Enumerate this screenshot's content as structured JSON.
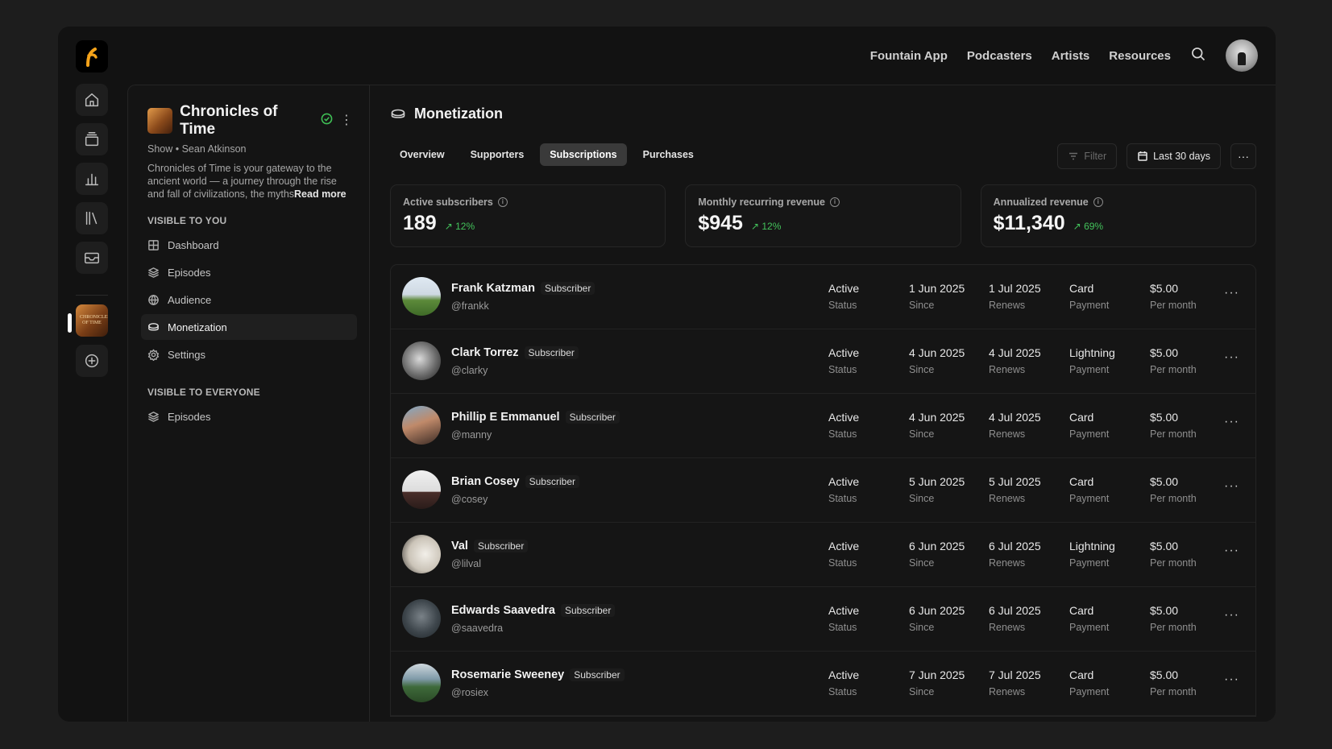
{
  "topnav": {
    "links": [
      "Fountain App",
      "Podcasters",
      "Artists",
      "Resources"
    ]
  },
  "rail": {
    "items": [
      "home-icon",
      "layers-icon",
      "analytics-icon",
      "library-icon",
      "inbox-icon"
    ],
    "cover_text": "CHRONICLES OF TIME"
  },
  "show": {
    "title": "Chronicles of Time",
    "meta": "Show • Sean Atkinson",
    "description": "Chronicles of Time is your gateway to the ancient world — a journey through the rise and fall of civilizations, the myths",
    "read_more": "Read more"
  },
  "sidebar": {
    "visible_to_you": "VISIBLE TO YOU",
    "items_you": [
      {
        "label": "Dashboard",
        "icon": "dashboard-icon"
      },
      {
        "label": "Episodes",
        "icon": "episodes-icon"
      },
      {
        "label": "Audience",
        "icon": "audience-icon"
      },
      {
        "label": "Monetization",
        "icon": "monetization-icon",
        "active": true
      },
      {
        "label": "Settings",
        "icon": "settings-icon"
      }
    ],
    "visible_to_everyone": "VISIBLE TO EVERYONE",
    "items_everyone": [
      {
        "label": "Episodes",
        "icon": "episodes-icon"
      }
    ]
  },
  "page": {
    "title": "Monetization",
    "tabs": [
      "Overview",
      "Supporters",
      "Subscriptions",
      "Purchases"
    ],
    "active_tab": "Subscriptions",
    "filter_label": "Filter",
    "date_label": "Last 30 days"
  },
  "stats": [
    {
      "label": "Active subscribers",
      "value": "189",
      "delta": "12%"
    },
    {
      "label": "Monthly recurring revenue",
      "value": "$945",
      "delta": "12%"
    },
    {
      "label": "Annualized revenue",
      "value": "$11,340",
      "delta": "69%"
    }
  ],
  "labels": {
    "badge": "Subscriber",
    "status": "Status",
    "since": "Since",
    "renews": "Renews",
    "payment": "Payment",
    "per_month": "Per month"
  },
  "subscribers": [
    {
      "name": "Frank Katzman",
      "handle": "@frankk",
      "status": "Active",
      "since": "1 Jun 2025",
      "renews": "1 Jul 2025",
      "payment": "Card",
      "amount": "$5.00"
    },
    {
      "name": "Clark Torrez",
      "handle": "@clarky",
      "status": "Active",
      "since": "4 Jun 2025",
      "renews": "4 Jul 2025",
      "payment": "Lightning",
      "amount": "$5.00"
    },
    {
      "name": "Phillip E Emmanuel",
      "handle": "@manny",
      "status": "Active",
      "since": "4 Jun 2025",
      "renews": "4 Jul 2025",
      "payment": "Card",
      "amount": "$5.00"
    },
    {
      "name": "Brian Cosey",
      "handle": "@cosey",
      "status": "Active",
      "since": "5 Jun 2025",
      "renews": "5 Jul 2025",
      "payment": "Card",
      "amount": "$5.00"
    },
    {
      "name": "Val",
      "handle": "@lilval",
      "status": "Active",
      "since": "6 Jun 2025",
      "renews": "6 Jul 2025",
      "payment": "Lightning",
      "amount": "$5.00"
    },
    {
      "name": "Edwards Saavedra",
      "handle": "@saavedra",
      "status": "Active",
      "since": "6 Jun 2025",
      "renews": "6 Jul 2025",
      "payment": "Card",
      "amount": "$5.00"
    },
    {
      "name": "Rosemarie Sweeney",
      "handle": "@rosiex",
      "status": "Active",
      "since": "7 Jun 2025",
      "renews": "7 Jul 2025",
      "payment": "Card",
      "amount": "$5.00"
    }
  ],
  "colors": {
    "accent_green": "#43c35b",
    "logo_orange": "#f5a31a",
    "background": "#121212"
  }
}
